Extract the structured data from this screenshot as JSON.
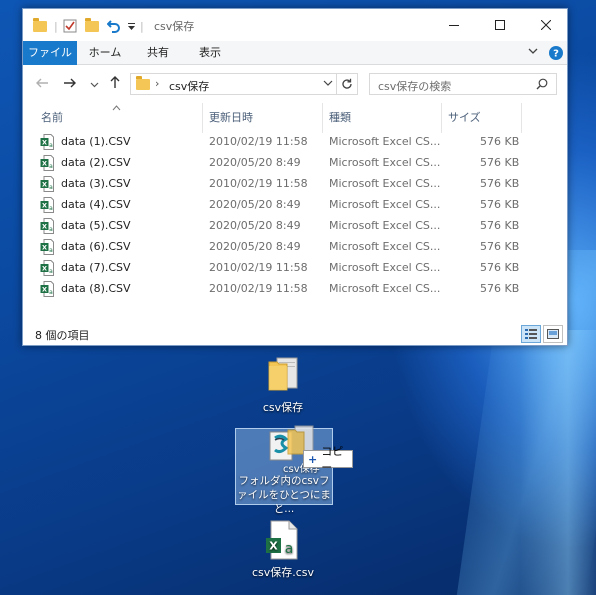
{
  "window": {
    "title": "csv保存",
    "tabs": [
      "ファイル",
      "ホーム",
      "共有",
      "表示"
    ],
    "address": "csv保存",
    "search_placeholder": "csv保存の検索",
    "columns": [
      "名前",
      "更新日時",
      "種類",
      "サイズ"
    ],
    "files": [
      {
        "name": "data (1).CSV",
        "date": "2010/02/19 11:58",
        "type": "Microsoft Excel CS...",
        "size": "576 KB"
      },
      {
        "name": "data (2).CSV",
        "date": "2020/05/20 8:49",
        "type": "Microsoft Excel CS...",
        "size": "576 KB"
      },
      {
        "name": "data (3).CSV",
        "date": "2010/02/19 11:58",
        "type": "Microsoft Excel CS...",
        "size": "576 KB"
      },
      {
        "name": "data (4).CSV",
        "date": "2020/05/20 8:49",
        "type": "Microsoft Excel CS...",
        "size": "576 KB"
      },
      {
        "name": "data (5).CSV",
        "date": "2020/05/20 8:49",
        "type": "Microsoft Excel CS...",
        "size": "576 KB"
      },
      {
        "name": "data (6).CSV",
        "date": "2020/05/20 8:49",
        "type": "Microsoft Excel CS...",
        "size": "576 KB"
      },
      {
        "name": "data (7).CSV",
        "date": "2010/02/19 11:58",
        "type": "Microsoft Excel CS...",
        "size": "576 KB"
      },
      {
        "name": "data (8).CSV",
        "date": "2010/02/19 11:58",
        "type": "Microsoft Excel CS...",
        "size": "576 KB"
      }
    ],
    "status": "8 個の項目"
  },
  "desktop": {
    "folder_label": "csv保存",
    "script_label": "フォルダ内のcsvファイルをひとつにまと...",
    "drag_label": "csv保存",
    "copy_tip": "コピー",
    "excel_label": "csv保存.csv"
  },
  "colors": {
    "accent": "#1979ca",
    "excel_green": "#1e7145",
    "folder_yellow": "#f3c655"
  }
}
